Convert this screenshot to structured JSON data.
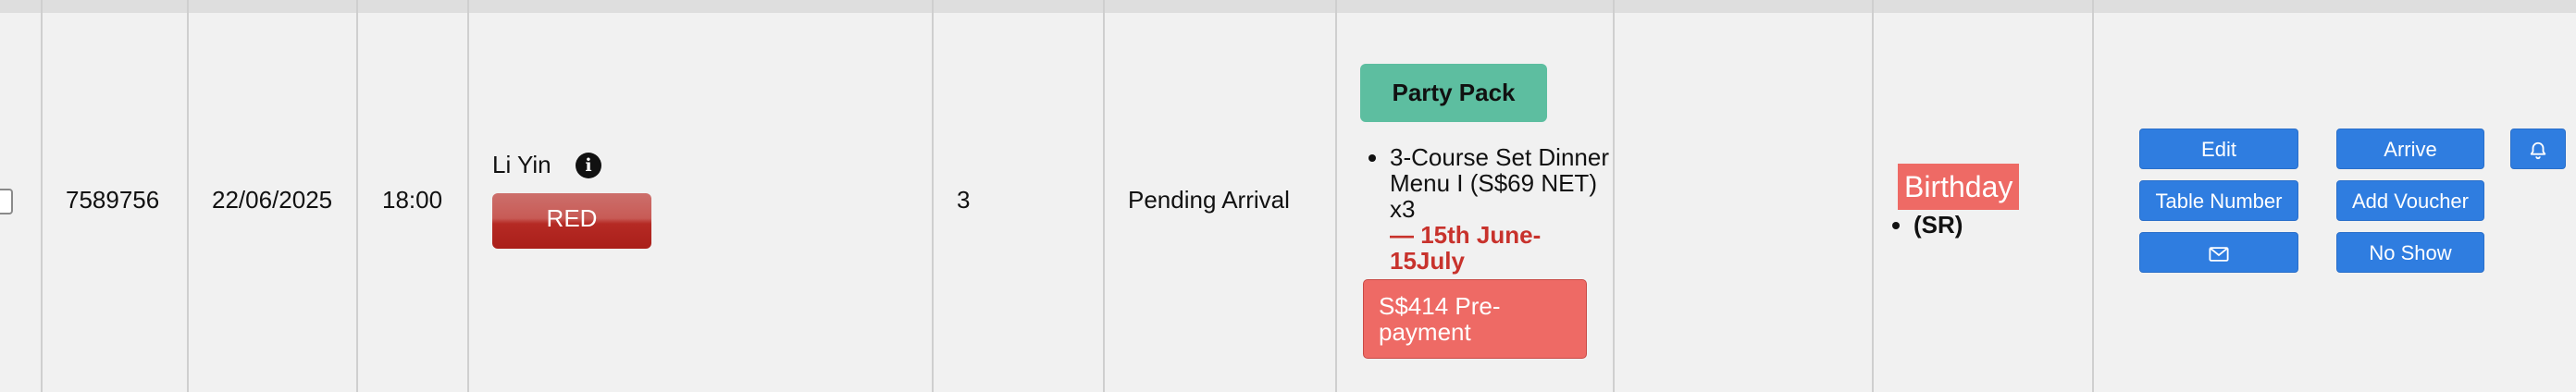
{
  "booking": {
    "id": "7589756",
    "date": "22/06/2025",
    "time": "18:00",
    "guest_name": "Li Yin",
    "tier": "RED",
    "pax": "3",
    "status": "Pending Arrival",
    "package": "Party Pack",
    "menu_item": "3-Course Set Dinner Menu I (S$69 NET) x3",
    "menu_dates": "— 15th June-15July",
    "prepayment": "S$414 Pre-payment",
    "occasion": "Birthday",
    "occasion_note": "(SR)"
  },
  "actions": {
    "edit": "Edit",
    "arrive": "Arrive",
    "table_number": "Table Number",
    "add_voucher": "Add Voucher",
    "no_show": "No Show"
  },
  "icons": {
    "info": "info-icon",
    "email": "envelope-icon",
    "notify": "bell-icon",
    "checkbox": "checkbox"
  },
  "colors": {
    "action_blue": "#2f7de0",
    "party_pack_green": "#5dbea0",
    "alert_red": "#ee6a65",
    "tier_red": "#b52a24",
    "menu_date_red": "#c8322c"
  }
}
